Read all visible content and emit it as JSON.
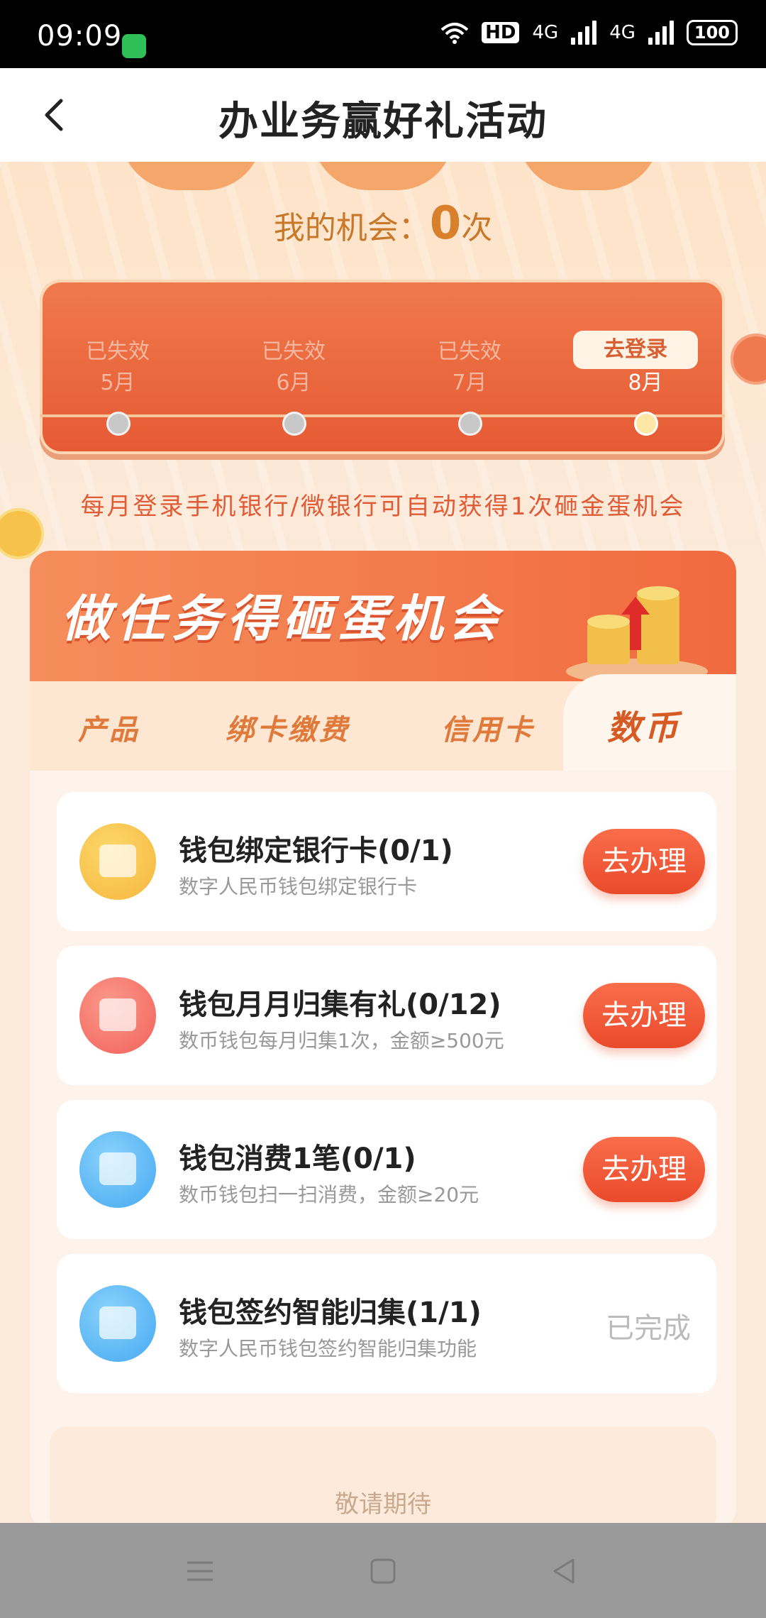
{
  "status_bar": {
    "time": "09:09",
    "hd_label": "HD",
    "net1": "4G",
    "net2": "4G",
    "battery": "100"
  },
  "header": {
    "title": "办业务赢好礼活动"
  },
  "banner": {
    "chance_prefix": "我的机会：",
    "chance_count": "0",
    "chance_suffix": "次"
  },
  "months": [
    {
      "status": "已失效",
      "label": "5月"
    },
    {
      "status": "已失效",
      "label": "6月"
    },
    {
      "status": "已失效",
      "label": "7月"
    },
    {
      "status": "去登录",
      "label": "8月"
    }
  ],
  "rule_text": "每月登录手机银行/微银行可自动获得1次砸金蛋机会",
  "task_section": {
    "title": "做任务得砸蛋机会",
    "tabs": [
      "产品",
      "绑卡缴费",
      "信用卡",
      "数币"
    ],
    "active_tab": "数币",
    "tasks": [
      {
        "name": "钱包绑定银行卡(0/1)",
        "desc": "数字人民币钱包绑定银行卡",
        "action": "去办理",
        "icon": "link-card-icon",
        "color": "#f6b63e"
      },
      {
        "name": "钱包月月归集有礼(0/12)",
        "desc": "数币钱包每月归集1次，金额≥500元",
        "action": "去办理",
        "icon": "calendar-clock-icon",
        "color": "#f2605a"
      },
      {
        "name": "钱包消费1笔(0/1)",
        "desc": "数币钱包扫一扫消费，金额≥20元",
        "action": "去办理",
        "icon": "shopping-bag-icon",
        "color": "#45a8f2"
      },
      {
        "name": "钱包签约智能归集(1/1)",
        "desc": "数字人民币钱包签约智能归集功能",
        "action": "已完成",
        "icon": "download-box-icon",
        "color": "#45a8f2"
      }
    ],
    "coming_soon": "敬请期待"
  }
}
